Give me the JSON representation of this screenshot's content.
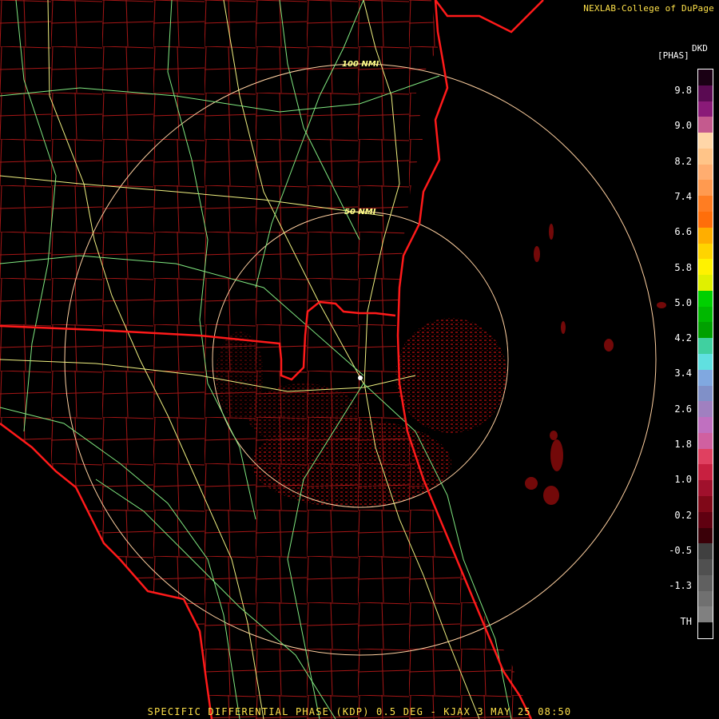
{
  "credit": "NEXLAB-College of DuPage",
  "product_code": "DKD",
  "units": "[PHAS]",
  "footer": "SPECIFIC DIFFERENTIAL PHASE (KDP) 0.5 DEG - KJAX 3 MAY 25 08:50",
  "range_rings": [
    {
      "label": "100 NMI"
    },
    {
      "label": "50 NMI"
    }
  ],
  "legend": {
    "labels": [
      "9.8",
      "9.0",
      "8.2",
      "7.4",
      "6.6",
      "5.8",
      "5.0",
      "4.2",
      "3.4",
      "2.6",
      "1.8",
      "1.0",
      "0.2",
      "-0.5",
      "-1.3",
      "TH"
    ],
    "colors": [
      "#1a0014",
      "#5a0a52",
      "#8a1a78",
      "#c45a8e",
      "#ffd6a8",
      "#ffc488",
      "#ffad70",
      "#ff9a50",
      "#ff7d22",
      "#ff6e0a",
      "#ffae00",
      "#ffd400",
      "#fff200",
      "#e0f000",
      "#00d000",
      "#00b800",
      "#00a000",
      "#40d0a0",
      "#60e0e0",
      "#80a8e0",
      "#8090c8",
      "#a080c0",
      "#c070c0",
      "#d060a0",
      "#e04060",
      "#c82040",
      "#a0102c",
      "#800818",
      "#600010",
      "#3a0008",
      "#404040",
      "#505050",
      "#606060",
      "#707070",
      "#808080",
      "#000000"
    ]
  },
  "colors": {
    "state_border": "#ff1a1a",
    "county_lines": "#b81818",
    "roads_major": "#f0f080",
    "roads_minor": "#80e880",
    "range_rings": "#ffd0a0",
    "echo": "#7a0a0a"
  }
}
